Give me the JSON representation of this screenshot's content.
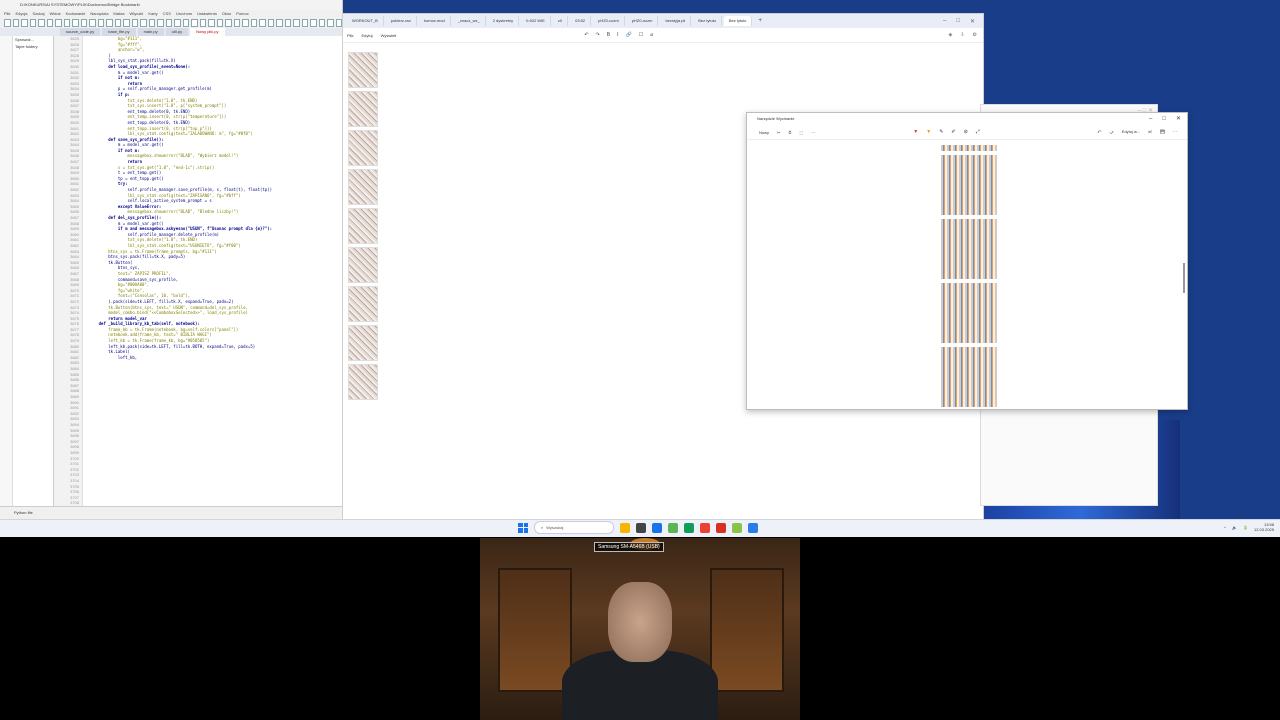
{
  "editor": {
    "title": "D:\\KONKURS\\AI SYSTEMOWY\\PLIK\\Duchomoc\\Bridge Bookmark\\",
    "menu": [
      "Plik",
      "Edycja",
      "Szukaj",
      "Widok",
      "Kodowanie",
      "Narzędzia",
      "Makra",
      "Wtyczki",
      "Karty",
      "CSS",
      "Uruchom",
      "Ustawienia",
      "Okno",
      "Pomoc"
    ],
    "tabs": [
      "source_code.py",
      "base_file.py",
      "main.py",
      "util.py",
      "Nowy plik.py"
    ],
    "files": [
      "Sprawdź...",
      "Tajne foldery"
    ],
    "gutter_lines": [
      "3625",
      "3626",
      "3627",
      "3628",
      "3629",
      "3630",
      "3631",
      "3632",
      "3633",
      "3634",
      "3635",
      "3636",
      "3637",
      "3638",
      "3639",
      "3640",
      "3641",
      "3642",
      "3643",
      "3644",
      "3645",
      "3646",
      "3647",
      "3648",
      "3649",
      "3650",
      "3651",
      "3652",
      "3653",
      "3654",
      "3655",
      "3656",
      "3657",
      "3658",
      "3659",
      "3660",
      "3661",
      "3662",
      "3663",
      "3664",
      "3665",
      "3666",
      "3667",
      "3668",
      "3669",
      "3670",
      "3671",
      "3672",
      "3673",
      "3674",
      "3675",
      "3676",
      "3677",
      "3678",
      "3679",
      "3680",
      "3681",
      "3682",
      "3683",
      "3684",
      "3685",
      "3686",
      "3687",
      "3688",
      "3689",
      "3690",
      "3691",
      "3692",
      "3693",
      "3694",
      "3695",
      "3696",
      "3697",
      "3698",
      "3699",
      "3700",
      "3701",
      "3702",
      "3703",
      "3704",
      "3705",
      "3706",
      "3707",
      "3708"
    ],
    "code_lines": [
      "            bg=\"#111\",",
      "            fg=\"#fff\",",
      "            anchor=\"w\",",
      "        )",
      "        lbl_sys_stat.pack(fill=tk.X)",
      "",
      "        def load_sys_profile(_event=None):",
      "            m = model_var.get()",
      "            if not m:",
      "                return",
      "            p = self.profile_manager.get_profile(m)",
      "            if p:",
      "                txt_sys.delete(\"1.0\", tk.END)",
      "                txt_sys.insert(\"1.0\", p[\"system_prompt\"])",
      "                ent_temp.delete(0, tk.END)",
      "                ent_temp.insert(0, str(p[\"temperature\"]))",
      "                ent_topp.delete(0, tk.END)",
      "                ent_topp.insert(0, str(p[\"top_p\"]))",
      "                lbl_sys_stat.config(text=\"ZALADOWANO: m\", fg=\"#0f0\")",
      "",
      "        def save_sys_profile():",
      "            m = model_var.get()",
      "            if not m:",
      "                messagebox.showerror(\"BLAD\", \"Wybierz model!\")",
      "                return",
      "            s = txt_sys.get(\"1.0\", \"end-1c\").strip()",
      "            t = ent_temp.get()",
      "            tp = ent_topp.get()",
      "            try:",
      "                self.profile_manager.save_profile(m, s, float(t), float(tp))",
      "                lbl_sys_stat.config(text=\"ZAPISANO\", fg=\"#0ff\")",
      "                self.local_active_system_prompt = s",
      "            except ValueError:",
      "                messagebox.showerror(\"BLAD\", \"Bledne liczby!\")",
      "",
      "        def del_sys_profile():",
      "            m = model_var.get()",
      "            if m and messagebox.askyesno(\"USUN\", f\"Usunac prompt dla {m}?\"):",
      "                self.profile_manager.delete_profile(m)",
      "                txt_sys.delete(\"1.0\", tk.END)",
      "                lbl_sys_stat.config(text=\"USUNIETO\", fg=\"#f00\")",
      "",
      "        btns_sys = tk.Frame(frame_prompts, bg=\"#111\")",
      "        btns_sys.pack(fill=tk.X, pady=5)",
      "        tk.Button(",
      "            btns_sys,",
      "            text=\" ZAPISZ PROFIL\",",
      "            command=save_sys_profile,",
      "            bg=\"#00AA00\",",
      "            fg=\"white\",",
      "            font=(\"Consolas\", 10, \"bold\"),",
      "        ).pack(side=tk.LEFT, fill=tk.X, expand=True, padx=2)",
      "        tk.Button(btns_sys, text=\" USUN\", command=del_sys_profile,",
      "",
      "        model_combo.bind(\"<<ComboboxSelected>>\", load_sys_profile)",
      "        return model_var",
      "",
      "    def _build_library_kb_tab(self, notebook):",
      "        frame_kb = tk.Frame(notebook, bg=self.colors[\"panel\"])",
      "        notebook.add(frame_kb, text=\" BIBLIA WAGI\")",
      "",
      "        left_kb = tk.Frame(frame_kb, bg=\"#050505\")",
      "        left_kb.pack(side=tk.LEFT, fill=tk.BOTH, expand=True, padx=5)",
      "        tk.Label(",
      "            left_kb,"
    ],
    "status": "Python file"
  },
  "browser": {
    "tabs": [
      "WORKOUT_B",
      "pobierz.csv",
      "komox.mod",
      "_znacz_wz_",
      "2 dyskretny",
      "0.602 WIE",
      "z0",
      "03:52",
      "pHZ0-oczm",
      "pHZ0-oczm",
      "bezstyja.pli",
      "Bez tytułu",
      "Bez tytułu"
    ],
    "active_tab_index": 12,
    "doc_menu": [
      "Plik",
      "Edytuj",
      "Wyświetl"
    ],
    "doc_tools": [
      "↶",
      "↷",
      "B",
      "I",
      "🔗",
      "☐",
      "⌀"
    ],
    "doc_right": [
      "◈",
      "⇩",
      "⚙"
    ],
    "thumb_count": 9
  },
  "viewer": {
    "title": "Narzędzie Wycinanie",
    "new_label": "Nowy",
    "tools_icons": [
      "✂",
      "⏱",
      "⬚",
      "⋯"
    ],
    "draw_icons": [
      "▼",
      "▼",
      "✎",
      "✐",
      "⊘",
      "⤢"
    ],
    "right_items": [
      "⤺",
      "⤻",
      "Edytuj w...",
      "🗐",
      "💾",
      "⋯"
    ],
    "window_controls": [
      "–",
      "□",
      "✕"
    ]
  },
  "taskbar": {
    "search_placeholder": "Wyszukaj",
    "apps": [
      "#f7b500",
      "#444",
      "#1a73e8",
      "#5ab552",
      "#0f9d58",
      "#ea4335",
      "#d93025",
      "#8bc34a",
      "#2b7de9"
    ],
    "tray_icons": [
      "^",
      "🔈",
      "🔋"
    ],
    "time": "13:58",
    "date": "12.03.2025"
  },
  "webcam": {
    "label": "Samsung SM-A546B (USB)"
  }
}
